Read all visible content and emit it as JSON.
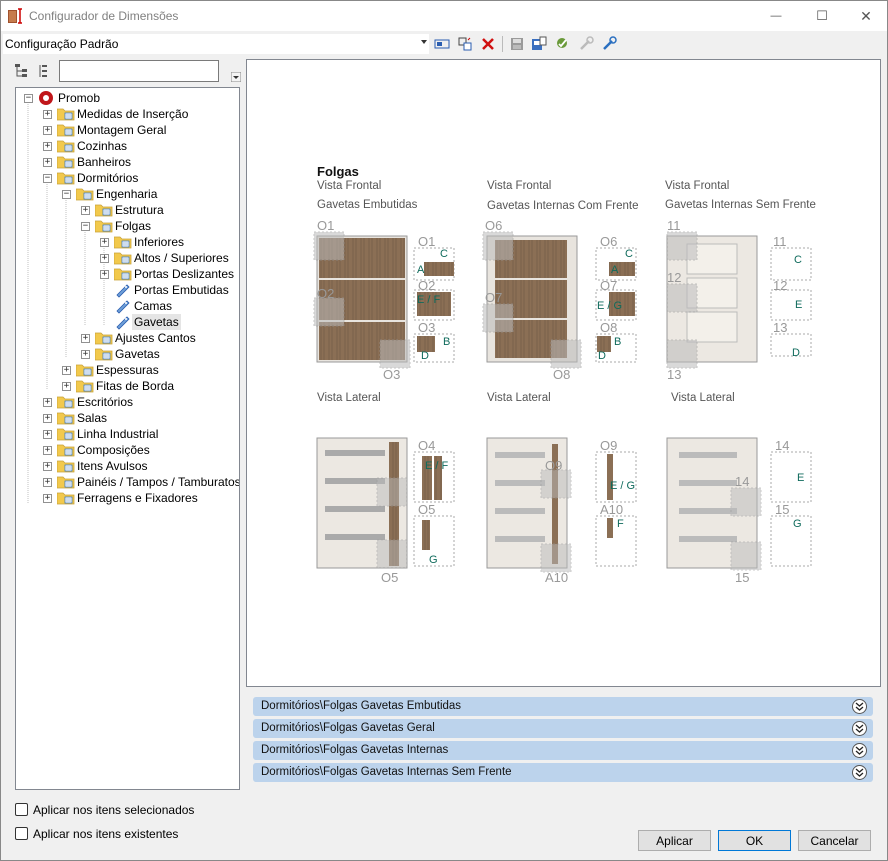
{
  "window": {
    "title": "Configurador de Dimensões",
    "min_symbol": "—",
    "max_symbol": "☐",
    "close_symbol": "✕"
  },
  "toolbar": {
    "config_value": "Configuração Padrão",
    "icons": [
      "rename-icon",
      "copy-config-icon",
      "delete-icon",
      "save-icon",
      "export-icon",
      "settings-check-icon",
      "tool-disabled-icon",
      "tool-icon"
    ]
  },
  "tree": {
    "search_placeholder": "",
    "nodes": [
      {
        "label": "Promob"
      },
      {
        "label": "Medidas de Inserção"
      },
      {
        "label": "Montagem Geral"
      },
      {
        "label": "Cozinhas"
      },
      {
        "label": "Banheiros"
      },
      {
        "label": "Dormitórios"
      },
      {
        "label": "Engenharia"
      },
      {
        "label": "Estrutura"
      },
      {
        "label": "Folgas"
      },
      {
        "label": "Inferiores"
      },
      {
        "label": "Altos / Superiores"
      },
      {
        "label": "Portas Deslizantes"
      },
      {
        "label": "Portas Embutidas"
      },
      {
        "label": "Camas"
      },
      {
        "label": "Gavetas"
      },
      {
        "label": "Ajustes Cantos"
      },
      {
        "label": "Gavetas"
      },
      {
        "label": "Espessuras"
      },
      {
        "label": "Fitas de Borda"
      },
      {
        "label": "Escritórios"
      },
      {
        "label": "Salas"
      },
      {
        "label": "Linha Industrial"
      },
      {
        "label": "Composições"
      },
      {
        "label": "Itens Avulsos"
      },
      {
        "label": "Painéis / Tampos / Tamburatos"
      },
      {
        "label": "Ferragens e Fixadores"
      }
    ]
  },
  "diagram": {
    "title": "Folgas",
    "vista_frontal": "Vista Frontal",
    "vista_lateral": "Vista Lateral",
    "col1_title": "Gavetas Embutidas",
    "col2_title": "Gavetas Internas Com Frente",
    "col3_title": "Gavetas Internas Sem Frente",
    "labels": {
      "o1": "O1",
      "o2": "O2",
      "o3": "O3",
      "o4": "O4",
      "o5": "O5",
      "o6": "O6",
      "o7": "O7",
      "o8": "O8",
      "o9": "O9",
      "a10": "A10",
      "n11": "11",
      "n12": "12",
      "n13": "13",
      "n14": "14",
      "n15": "15"
    },
    "letters": {
      "a": "A",
      "b": "B",
      "c": "C",
      "d": "D",
      "e": "E",
      "ef": "E / F",
      "eg": "E / G",
      "f": "F",
      "g": "G"
    }
  },
  "accordions": [
    {
      "label": "Dormitórios\\Folgas Gavetas Embutidas"
    },
    {
      "label": "Dormitórios\\Folgas Gavetas Geral"
    },
    {
      "label": "Dormitórios\\Folgas Gavetas Internas"
    },
    {
      "label": "Dormitórios\\Folgas Gavetas Internas Sem Frente"
    }
  ],
  "options": {
    "apply_selected": "Aplicar nos itens selecionados",
    "apply_existing": "Aplicar nos itens existentes"
  },
  "buttons": {
    "apply": "Aplicar",
    "ok": "OK",
    "cancel": "Cancelar"
  },
  "colors": {
    "accordion_bg": "#bcd3ec",
    "dimension_green": "#0f6b5c",
    "wood": "#8b6f55"
  }
}
